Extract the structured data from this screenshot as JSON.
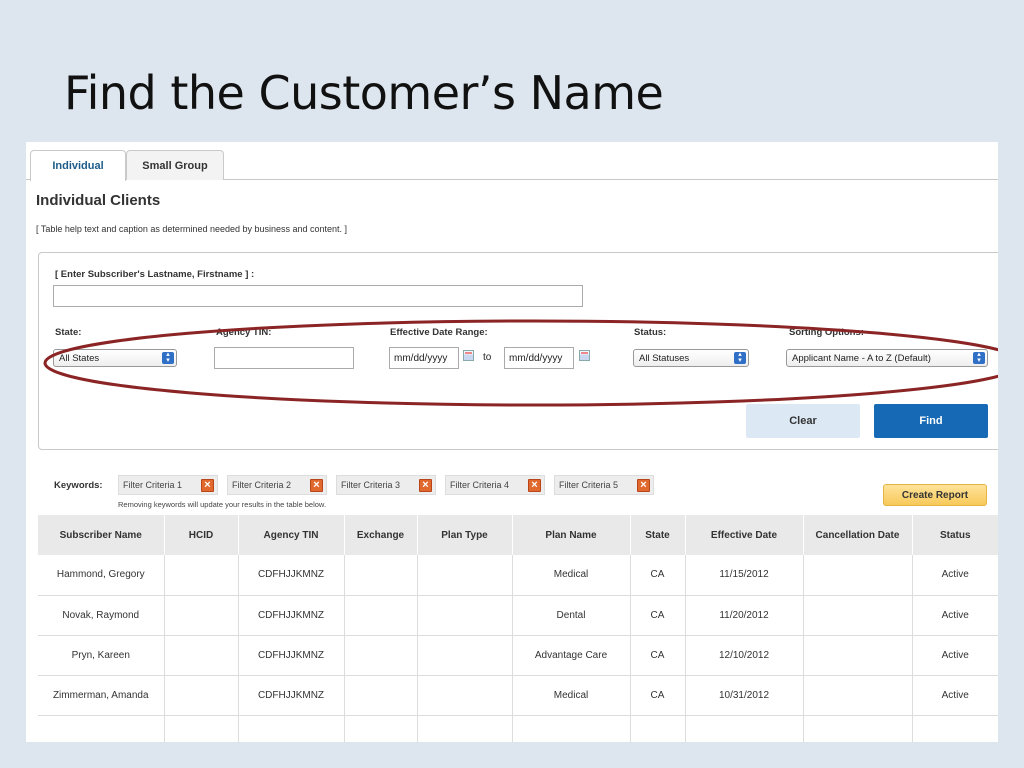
{
  "slide": {
    "title": "Find the Customer’s Name"
  },
  "tabs": [
    {
      "label": "Individual",
      "active": true
    },
    {
      "label": "Small Group",
      "active": false
    }
  ],
  "page": {
    "title": "Individual Clients",
    "help_text": "[ Table help text and caption as determined needed by business and content. ]"
  },
  "search": {
    "subscriber_label": "[ Enter Subscriber's Lastname, Firstname ] :",
    "subscriber_value": "",
    "state_label": "State:",
    "state_value": "All States",
    "agency_tin_label": "Agency TIN:",
    "agency_tin_value": "",
    "date_range_label": "Effective Date Range:",
    "date_from": "mm/dd/yyyy",
    "date_to_label": "to",
    "date_to": "mm/dd/yyyy",
    "status_label": "Status:",
    "status_value": "All Statuses",
    "sorting_label": "Sorting Options:",
    "sorting_value": "Applicant Name - A to Z (Default)",
    "clear_label": "Clear",
    "find_label": "Find"
  },
  "keywords": {
    "label": "Keywords:",
    "chips": [
      "Filter Criteria 1",
      "Filter Criteria 2",
      "Filter Criteria 3",
      "Filter Criteria 4",
      "Filter Criteria 5"
    ],
    "note": "Removing keywords will update your results in the table below.",
    "report_label": "Create Report"
  },
  "table": {
    "headers": [
      "Subscriber Name",
      "HCID",
      "Agency TIN",
      "Exchange",
      "Plan Type",
      "Plan Name",
      "State",
      "Effective Date",
      "Cancellation Date",
      "Status"
    ],
    "rows": [
      [
        "Hammond, Gregory",
        "",
        "CDFHJJKMNZ",
        "",
        "",
        "Medical",
        "CA",
        "11/15/2012",
        "",
        "Active"
      ],
      [
        "Novak, Raymond",
        "",
        "CDFHJJKMNZ",
        "",
        "",
        "Dental",
        "CA",
        "11/20/2012",
        "",
        "Active"
      ],
      [
        "Pryn, Kareen",
        "",
        "CDFHJJKMNZ",
        "",
        "",
        "Advantage Care",
        "CA",
        "12/10/2012",
        "",
        "Active"
      ],
      [
        "Zimmerman, Amanda",
        "",
        "CDFHJJKMNZ",
        "",
        "",
        "Medical",
        "CA",
        "10/31/2012",
        "",
        "Active"
      ],
      [
        "",
        "",
        "",
        "",
        "",
        "",
        "",
        "",
        "",
        ""
      ]
    ]
  },
  "colors": {
    "highlight_oval": "#8b2424",
    "find_button": "#1669b4",
    "accent_tab": "#1d5c8a"
  }
}
